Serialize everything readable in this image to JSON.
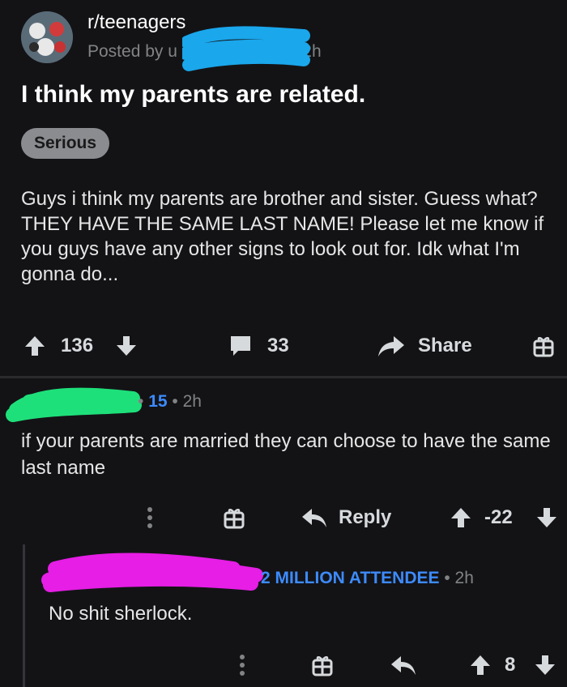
{
  "post": {
    "subreddit": "r/teenagers",
    "posted_by": "Posted by u",
    "age": "2h",
    "title": "I think my parents are related.",
    "flair": "Serious",
    "body": "Guys i think my parents are brother and sister. Guess what? THEY HAVE THE SAME LAST NAME! Please let me know if you guys have any other signs to look out for. Idk what I'm gonna do...",
    "upvotes": "136",
    "comments": "33",
    "share_label": "Share"
  },
  "comment1": {
    "score": "15",
    "age": "2h",
    "text": "if your parents are married they can choose to have the same last name",
    "reply_label": "Reply",
    "votes": "-22"
  },
  "comment2": {
    "user_flair": "2 MILLION ATTENDEE",
    "age": "2h",
    "text": "No shit sherlock.",
    "votes": "8"
  },
  "colors": {
    "background": "#131316",
    "blue_redaction": "#1aa7ec",
    "green_redaction": "#1ee07a",
    "magenta_redaction": "#e61ee6",
    "accent_blue": "#3d8bfd"
  },
  "icons": [
    "upvote-arrow-icon",
    "downvote-arrow-icon",
    "comment-bubble-icon",
    "share-arrow-icon",
    "gift-icon",
    "more-vertical-icon",
    "reply-arrow-icon"
  ]
}
